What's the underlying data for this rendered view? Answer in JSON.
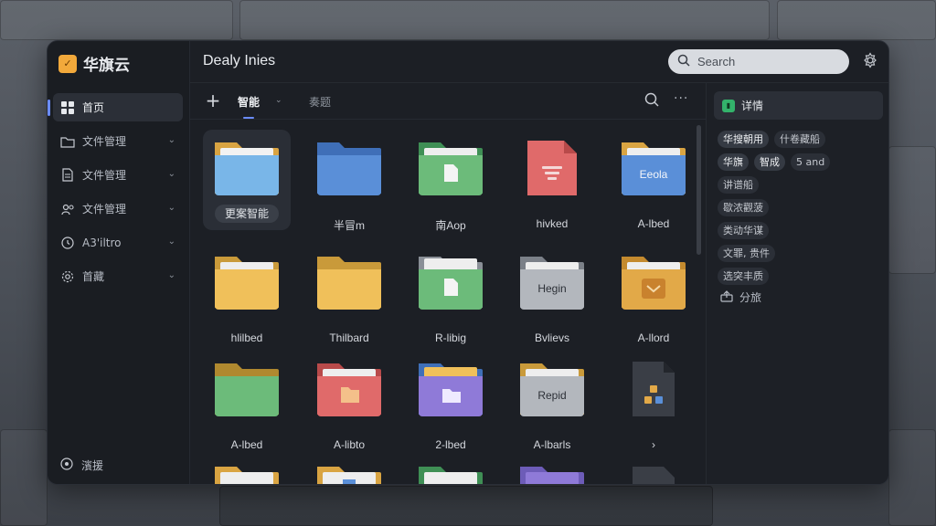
{
  "brand": {
    "name": "华旗云",
    "logo_glyph": "✓"
  },
  "sidebar": {
    "items": [
      {
        "label": "首页",
        "icon": "grid-icon",
        "active": true,
        "expandable": false
      },
      {
        "label": "文件管理",
        "icon": "folder-icon",
        "active": false,
        "expandable": true
      },
      {
        "label": "文件管理",
        "icon": "document-icon",
        "active": false,
        "expandable": true
      },
      {
        "label": "文件管理",
        "icon": "users-icon",
        "active": false,
        "expandable": true
      },
      {
        "label": "A3'iltro",
        "icon": "clock-icon",
        "active": false,
        "expandable": true
      },
      {
        "label": "首藏",
        "icon": "gear-icon",
        "active": false,
        "expandable": true
      }
    ],
    "footer_label": "濱援"
  },
  "titlebar": {
    "title": "Dealy Inies"
  },
  "search": {
    "placeholder": "Search"
  },
  "toolbar": {
    "tabs": [
      {
        "label": "智能",
        "active": true
      },
      {
        "label": "奏题",
        "active": false
      }
    ]
  },
  "files": [
    {
      "label": "更案智能",
      "type": "folder-blue-light",
      "selected": true
    },
    {
      "label": "半冒m",
      "type": "folder-blue"
    },
    {
      "label": "南Aop",
      "type": "folder-green-doc"
    },
    {
      "label": "hivked",
      "type": "file-red"
    },
    {
      "label": "A-lbed",
      "type": "folder-blue-text",
      "folder_text": "Eeola"
    },
    {
      "label": "hlilbed",
      "type": "folder-yellow"
    },
    {
      "label": "Thilbard",
      "type": "folder-yellow"
    },
    {
      "label": "R-libig",
      "type": "folder-green-doc"
    },
    {
      "label": "Bvlievs",
      "type": "folder-gray-text",
      "folder_text": "Hegin"
    },
    {
      "label": "A-llord",
      "type": "folder-orange-box"
    },
    {
      "label": "A-lbed",
      "type": "folder-green"
    },
    {
      "label": "A-libto",
      "type": "folder-red"
    },
    {
      "label": "2-lbed",
      "type": "folder-purple"
    },
    {
      "label": "A-lbarls",
      "type": "folder-gray-text",
      "folder_text": "Repid"
    },
    {
      "label": "›",
      "type": "file-dark"
    }
  ],
  "details": {
    "title": "详情",
    "tags": [
      [
        "华搜朝用",
        "什卷藏船"
      ],
      [
        "华旗",
        "智成",
        "5 and"
      ],
      [
        "讲谱船"
      ],
      [
        "歇浓觀菠"
      ],
      [
        "类动华谋"
      ],
      [
        "文罪, 贵件"
      ],
      [
        "选突丰质"
      ]
    ],
    "strong_tags": [
      "华搜朝用",
      "华旗",
      "智成"
    ],
    "share_label": "分旅"
  },
  "colors": {
    "accent": "#6b8cff",
    "window_bg": "#1c1f25",
    "folder_blue": "#5a8fd8",
    "folder_yellow": "#f0c05a",
    "folder_green": "#6cbb7a",
    "folder_red": "#e06a6a",
    "folder_purple": "#8f7ad8"
  }
}
